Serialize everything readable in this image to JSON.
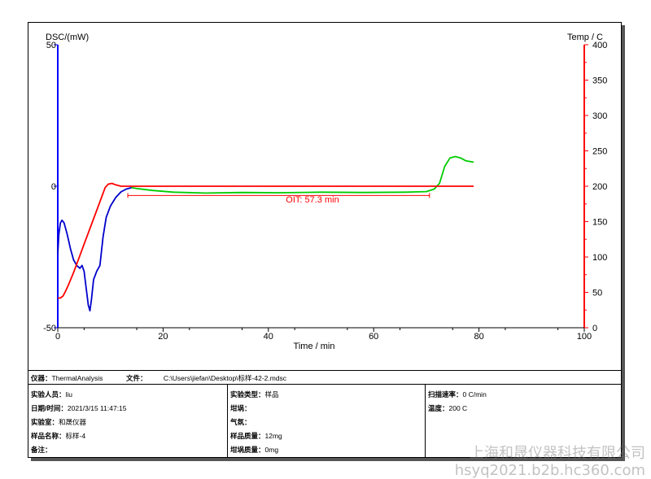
{
  "chart_data": {
    "type": "line",
    "left_axis_label": "DSC/(mW)",
    "right_axis_label": "Temp / C",
    "xlabel": "Time / min",
    "xlim": [
      0,
      100
    ],
    "x_ticks": [
      "0",
      "20",
      "40",
      "60",
      "80",
      "100"
    ],
    "left_ylim": [
      -50,
      50
    ],
    "left_ticks": [
      "50",
      "0",
      "-50"
    ],
    "right_ylim": [
      0,
      400
    ],
    "right_ticks": [
      "400",
      "350",
      "300",
      "250",
      "200",
      "150",
      "100",
      "50",
      "0"
    ],
    "annotation": "OIT:   57.3 min",
    "oit_range": [
      13.3,
      70.6
    ],
    "series": [
      {
        "axis": "left",
        "color": "#0000cc",
        "points": [
          [
            0,
            -24
          ],
          [
            0.2,
            -17
          ],
          [
            0.5,
            -13
          ],
          [
            0.8,
            -12
          ],
          [
            1.2,
            -13
          ],
          [
            1.8,
            -17
          ],
          [
            2.4,
            -22
          ],
          [
            3,
            -26
          ],
          [
            3.6,
            -28
          ],
          [
            4.2,
            -29
          ],
          [
            4.6,
            -28
          ],
          [
            5,
            -30
          ],
          [
            5.4,
            -36
          ],
          [
            5.8,
            -42
          ],
          [
            6.1,
            -44
          ],
          [
            6.4,
            -40
          ],
          [
            6.8,
            -33
          ],
          [
            7.4,
            -30
          ],
          [
            8,
            -28
          ],
          [
            8.6,
            -18
          ],
          [
            9.2,
            -11
          ],
          [
            10,
            -7
          ],
          [
            11,
            -4
          ],
          [
            12,
            -2
          ],
          [
            13,
            -1
          ],
          [
            14,
            -0.5
          ]
        ]
      },
      {
        "axis": "left",
        "color": "#00cc00",
        "points": [
          [
            14,
            -0.5
          ],
          [
            15,
            -0.8
          ],
          [
            18,
            -1.5
          ],
          [
            22,
            -2.1
          ],
          [
            28,
            -2.4
          ],
          [
            35,
            -2.2
          ],
          [
            42,
            -2.3
          ],
          [
            50,
            -2.1
          ],
          [
            58,
            -2.2
          ],
          [
            66,
            -2.1
          ],
          [
            70,
            -1.9
          ],
          [
            71.5,
            -1
          ],
          [
            72.5,
            1
          ],
          [
            73.5,
            7
          ],
          [
            74.5,
            10
          ],
          [
            75.5,
            10.5
          ],
          [
            76.5,
            10
          ],
          [
            77.5,
            9
          ],
          [
            79,
            8.5
          ]
        ]
      },
      {
        "axis": "right",
        "color": "#ff0000",
        "points": [
          [
            0,
            42
          ],
          [
            0.5,
            42
          ],
          [
            1,
            45
          ],
          [
            1.5,
            52
          ],
          [
            2,
            60
          ],
          [
            3,
            78
          ],
          [
            4,
            98
          ],
          [
            5,
            118
          ],
          [
            6,
            138
          ],
          [
            7,
            158
          ],
          [
            8,
            178
          ],
          [
            9,
            198
          ],
          [
            9.6,
            203
          ],
          [
            10.3,
            204
          ],
          [
            11,
            202
          ],
          [
            12,
            200
          ],
          [
            14,
            200
          ],
          [
            20,
            200
          ],
          [
            40,
            200
          ],
          [
            60,
            200
          ],
          [
            79,
            200
          ]
        ]
      }
    ]
  },
  "info": {
    "instrument_label": "仪器：",
    "instrument_value": "ThermalAnalysis",
    "file_label": "文件：",
    "file_value": "C:\\Users\\jiefan\\Desktop\\标样-42-2.mdsc",
    "col1": [
      {
        "label": "实验人员：",
        "value": "liu"
      },
      {
        "label": "日期/时间：",
        "value": "2021/3/15 11:47:15"
      },
      {
        "label": "实验室：",
        "value": "和晟仪器"
      },
      {
        "label": "样品名称：",
        "value": "标样-4"
      },
      {
        "label": "备注：",
        "value": ""
      }
    ],
    "col2": [
      {
        "label": "实验类型：",
        "value": "样品"
      },
      {
        "label": "坩埚：",
        "value": ""
      },
      {
        "label": "气氛：",
        "value": ""
      },
      {
        "label": "样品质量：",
        "value": "12mg"
      },
      {
        "label": "坩埚质量：",
        "value": "0mg"
      }
    ],
    "col3": [
      {
        "label": "扫描速率：",
        "value": "0 C/min"
      },
      {
        "label": "温度：",
        "value": "200 C"
      }
    ]
  },
  "watermark": {
    "line1": "上海和晟仪器科技有限公司",
    "line2": "hsyq2021.b2b.hc360.com"
  }
}
